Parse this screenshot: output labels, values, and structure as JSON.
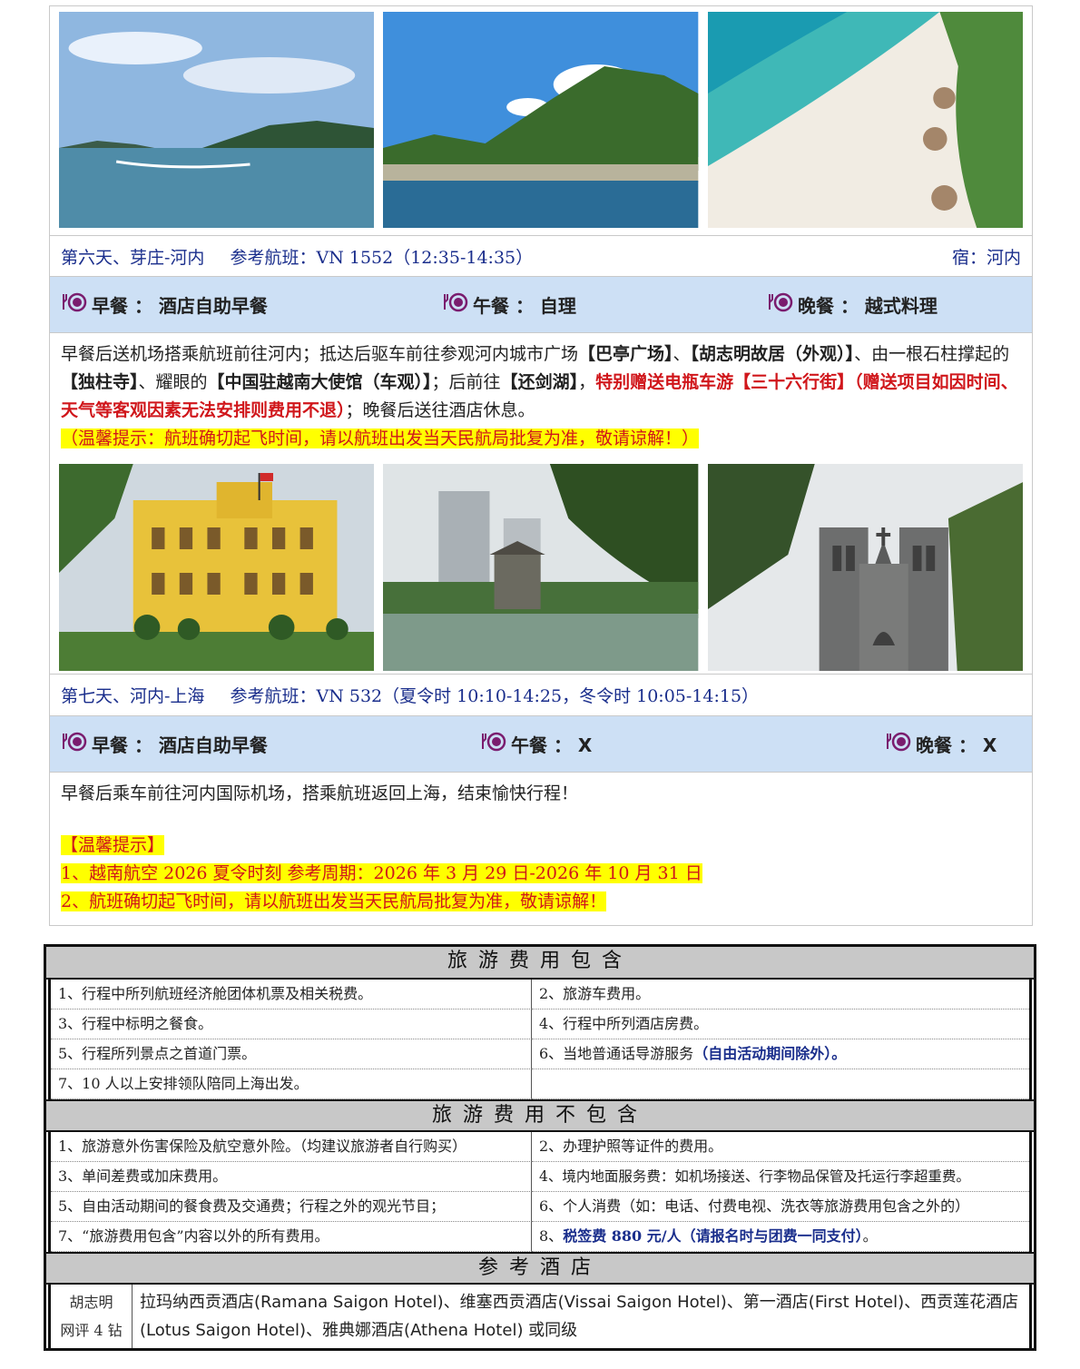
{
  "day6": {
    "title": "第六天、芽庄-河内",
    "flight": "参考航班：VN 1552（12:35-14:35）",
    "stay": "宿：河内",
    "breakfast": "早餐 ： 酒店自助早餐",
    "lunch": "午餐 ： 自理",
    "dinner": "晚餐 ： 越式料理",
    "desc_1": "早餐后送机场搭乘航班前往河内；抵达后驱车前往参观河内城市广场",
    "spot_1": "【巴亭广场】",
    "desc_2": "、",
    "spot_2": "【胡志明故居（外观）】",
    "desc_3": "、由一根石柱撑起的",
    "spot_3": "【独柱寺】",
    "desc_4": "、耀眼的",
    "spot_4": "【中国驻越南大使馆（车观）】",
    "desc_5": "；后前往",
    "spot_5": "【还剑湖】",
    "desc_6": "，",
    "red_1": "特别赠送电瓶车游【三十六行街】（赠送项目如因时间、天气等客观因素无法安排则费用不退）",
    "desc_7": "；晚餐后送往酒店休息。",
    "tip": "（温馨提示：航班确切起飞时间，请以航班出发当天民航局批复为准，敬请谅解！）"
  },
  "day7": {
    "title": "第七天、河内-上海",
    "flight": "参考航班：VN 532（夏令时 10:10-14:25，冬令时 10:05-14:15）",
    "breakfast": "早餐 ： 酒店自助早餐",
    "lunch": "午餐 ： X",
    "dinner": "晚餐 ： X",
    "desc": "早餐后乘车前往河内国际机场，搭乘航班返回上海，结束愉快行程！",
    "tip_title": "【温馨提示】",
    "tip_1": "1、越南航空 2026 夏令时刻 参考周期：2026 年 3 月 29 日-2026 年 10 月 31 日",
    "tip_2": "2、航班确切起飞时间，请以航班出发当天民航局批复为准，敬请谅解！"
  },
  "include": {
    "title": "旅游费用包含",
    "items": [
      "1、行程中所列航班经济舱团体机票及相关税费。",
      "2、旅游车费用。",
      "3、行程中标明之餐食。",
      "4、行程中所列酒店房费。",
      "5、行程所列景点之首道门票。",
      "6、当地普通话导游服务",
      "7、10 人以上安排领队陪同上海出发。",
      ""
    ],
    "item6_extra": "（自由活动期间除外）。"
  },
  "exclude": {
    "title": "旅游费用不包含",
    "items": [
      "1、旅游意外伤害保险及航空意外险。（均建议旅游者自行购买）",
      "2、办理护照等证件的费用。",
      "3、单间差费或加床费用。",
      "4、境内地面服务费：如机场接送、行李物品保管及托运行李超重费。",
      "5、自由活动期间的餐食费及交通费；行程之外的观光节目；",
      "6、个人消费（如：电话、付费电视、洗衣等旅游费用包含之外的）",
      "7、“旅游费用包含”内容以外的所有费用。",
      "8、"
    ],
    "item8_extra": "税签费 880 元/人（请报名时与团费一同支付）",
    "item8_end": "。"
  },
  "hotel": {
    "title": "参考酒店",
    "city": "胡志明",
    "rating": "网评 4 钻",
    "list": "拉玛纳西贡酒店(Ramana Saigon Hotel)、维塞西贡酒店(Vissai Saigon Hotel)、第一酒店(First Hotel)、西贡莲花酒店(Lotus Saigon Hotel)、雅典娜酒店(Athena Hotel) 或同级"
  }
}
